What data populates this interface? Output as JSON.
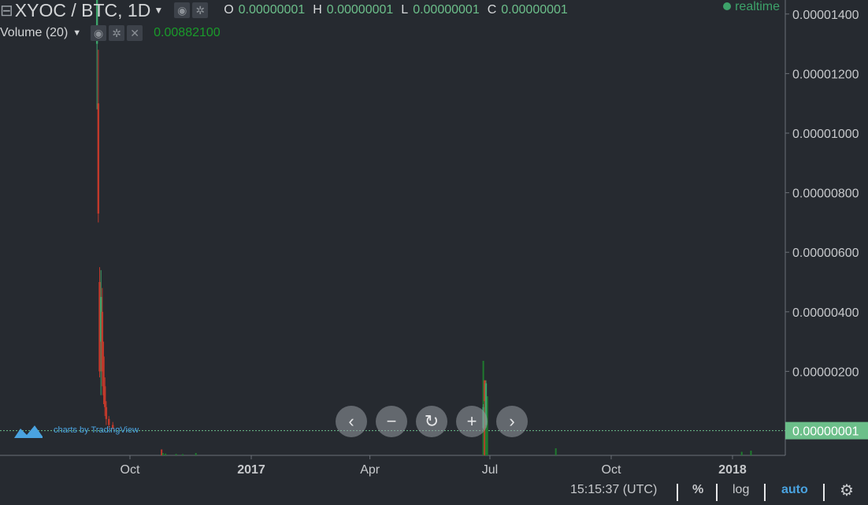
{
  "header": {
    "symbol": "XYOC / BTC, 1D",
    "ohlc": [
      {
        "key": "O",
        "value": "0.00000001"
      },
      {
        "key": "H",
        "value": "0.00000001"
      },
      {
        "key": "L",
        "value": "0.00000001"
      },
      {
        "key": "C",
        "value": "0.00000001"
      }
    ],
    "realtime": "realtime"
  },
  "volume_legend": {
    "label": "Volume (20)",
    "value": "0.00882100"
  },
  "watermark": {
    "text": "charts by TradingView"
  },
  "bottom": {
    "time": "15:15:37 (UTC)",
    "percent": "%",
    "log": "log",
    "auto": "auto"
  },
  "colors": {
    "up": "#3da36a",
    "down": "#c0392b",
    "volume_up": "#1f7a2e",
    "volume_down": "#c0392b",
    "text": "#c7c9cc"
  },
  "chart_data": {
    "type": "candlestick",
    "price_axis": {
      "ticks": [
        "0.00001400",
        "0.00001200",
        "0.00001000",
        "0.00000800",
        "0.00000600",
        "0.00000400",
        "0.00000200"
      ],
      "ylim": [
        0,
        1.48e-05
      ],
      "last_price": "0.00000001"
    },
    "time_axis": {
      "ticks": [
        "Oct",
        "2017",
        "Apr",
        "Jul",
        "Oct",
        "2018"
      ],
      "bold": [
        "2017",
        "2018"
      ],
      "dates": [
        "2016-10-01",
        "2017-01-01",
        "2017-04-01",
        "2017-07-01",
        "2017-10-01",
        "2018-01-01"
      ]
    },
    "candles": [
      {
        "date": "2016-09-06",
        "open": 1.3e-05,
        "close": 1.47e-05,
        "high": 1.5e-05,
        "low": 1.08e-05
      },
      {
        "date": "2016-09-07",
        "open": 1.1e-05,
        "close": 7.3e-06,
        "high": 1.28e-05,
        "low": 7e-06
      },
      {
        "date": "2016-09-08",
        "open": 5e-06,
        "close": 2e-06,
        "high": 5.5e-06,
        "low": 1.8e-06
      },
      {
        "date": "2016-09-09",
        "open": 3e-06,
        "close": 4.5e-06,
        "high": 5.4e-06,
        "low": 1.2e-06
      },
      {
        "date": "2016-09-10",
        "open": 4e-06,
        "close": 2e-06,
        "high": 4.8e-06,
        "low": 1.5e-06
      },
      {
        "date": "2016-09-11",
        "open": 2.5e-06,
        "close": 1.2e-06,
        "high": 3e-06,
        "low": 9e-07
      },
      {
        "date": "2016-09-12",
        "open": 1.5e-06,
        "close": 8e-07,
        "high": 1.8e-06,
        "low": 5e-07
      },
      {
        "date": "2016-09-13",
        "open": 8e-07,
        "close": 4e-07,
        "high": 1e-06,
        "low": 2e-07
      },
      {
        "date": "2016-09-15",
        "open": 4e-07,
        "close": 2e-07,
        "high": 5e-07,
        "low": 1e-07
      },
      {
        "date": "2016-09-18",
        "open": 2e-07,
        "close": 1e-07,
        "high": 3e-07,
        "low": 5e-08
      },
      {
        "date": "2017-06-26",
        "open": 1e-07,
        "close": 8e-07,
        "high": 9e-07,
        "low": 5e-08
      },
      {
        "date": "2017-06-27",
        "open": 1.7e-06,
        "close": 1e-06,
        "high": 1.7e-06,
        "low": 5e-07
      },
      {
        "date": "2017-06-28",
        "open": 2e-07,
        "close": 1.6e-06,
        "high": 1.7e-06,
        "low": 1e-07
      }
    ],
    "volume_bars": [
      {
        "date": "2016-10-25",
        "value": 0.05,
        "dir": "down"
      },
      {
        "date": "2016-10-26",
        "value": 0.02,
        "dir": "up"
      },
      {
        "date": "2016-10-28",
        "value": 0.015,
        "dir": "up"
      },
      {
        "date": "2016-11-05",
        "value": 0.012,
        "dir": "up"
      },
      {
        "date": "2016-11-10",
        "value": 0.01,
        "dir": "up"
      },
      {
        "date": "2016-11-20",
        "value": 0.02,
        "dir": "up"
      },
      {
        "date": "2017-06-26",
        "value": 0.8,
        "dir": "up"
      },
      {
        "date": "2017-06-27",
        "value": 0.35,
        "dir": "down"
      },
      {
        "date": "2017-06-28",
        "value": 0.35,
        "dir": "up"
      },
      {
        "date": "2017-06-29",
        "value": 0.5,
        "dir": "up"
      },
      {
        "date": "2017-08-20",
        "value": 0.06,
        "dir": "up"
      },
      {
        "date": "2018-01-08",
        "value": 0.03,
        "dir": "up"
      },
      {
        "date": "2018-01-15",
        "value": 0.04,
        "dir": "up"
      }
    ],
    "volume_max": 1.0
  }
}
